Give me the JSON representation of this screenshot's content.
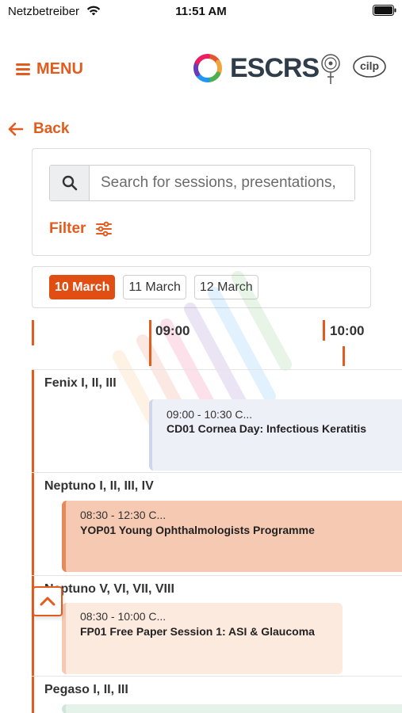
{
  "status_bar": {
    "carrier": "Netzbetreiber",
    "time": "11:51 AM"
  },
  "header": {
    "menu_label": "MENU",
    "logo_text": "ESCRS",
    "partner_logo_2_text": "cilp"
  },
  "nav": {
    "back_label": "Back"
  },
  "search": {
    "placeholder": "Search for sessions, presentations,",
    "value": "",
    "filter_label": "Filter"
  },
  "dates": [
    {
      "label": "10 March",
      "active": true
    },
    {
      "label": "11 March",
      "active": false
    },
    {
      "label": "12 March",
      "active": false
    }
  ],
  "timeline": {
    "ticks": [
      "09:00",
      "10:00"
    ]
  },
  "rooms": [
    {
      "name": "Fenix I, II, III",
      "sessions": [
        {
          "time": "09:00 - 10:30 C...",
          "title": "CD01 Cornea Day: Infectious Keratitis",
          "color": "#eef0f8"
        }
      ]
    },
    {
      "name": "Neptuno I, II, III, IV",
      "sessions": [
        {
          "time": "08:30 - 12:30 C...",
          "title": "YOP01 Young Ophthalmologists Programme",
          "color": "#f6c9b3"
        }
      ]
    },
    {
      "name": "Neptuno V, VI, VII, VIII",
      "sessions": [
        {
          "time": "08:30 - 10:00 C...",
          "title": "FP01 Free Paper Session 1: ASI & Glaucoma",
          "color": "#fdeadf"
        }
      ]
    },
    {
      "name": "Pegaso I, II, III",
      "sessions": []
    }
  ],
  "colors": {
    "accent": "#e35b1d",
    "active_tab": "#e04e13"
  }
}
